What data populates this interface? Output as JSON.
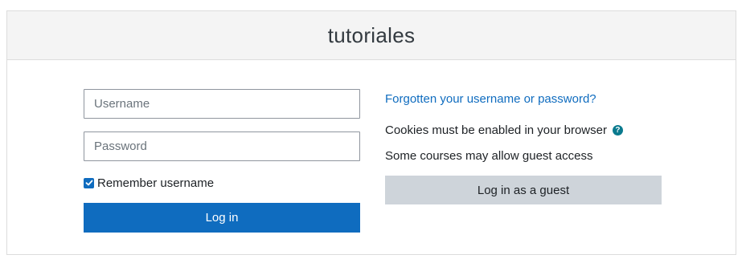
{
  "site": {
    "title": "tutoriales"
  },
  "login": {
    "username_placeholder": "Username",
    "username_value": "",
    "password_placeholder": "Password",
    "password_value": "",
    "remember_label": "Remember username",
    "remember_checked": true,
    "login_button": "Log in"
  },
  "help": {
    "forgot_link": "Forgotten your username or password?",
    "cookies_text": "Cookies must be enabled in your browser",
    "help_icon": "question-circle-icon",
    "guest_text": "Some courses may allow guest access",
    "guest_button": "Log in as a guest"
  },
  "colors": {
    "primary": "#0f6cbf",
    "secondary_button": "#ced4da",
    "header_bg": "#f4f4f4",
    "help_icon": "#0a7a8e"
  }
}
